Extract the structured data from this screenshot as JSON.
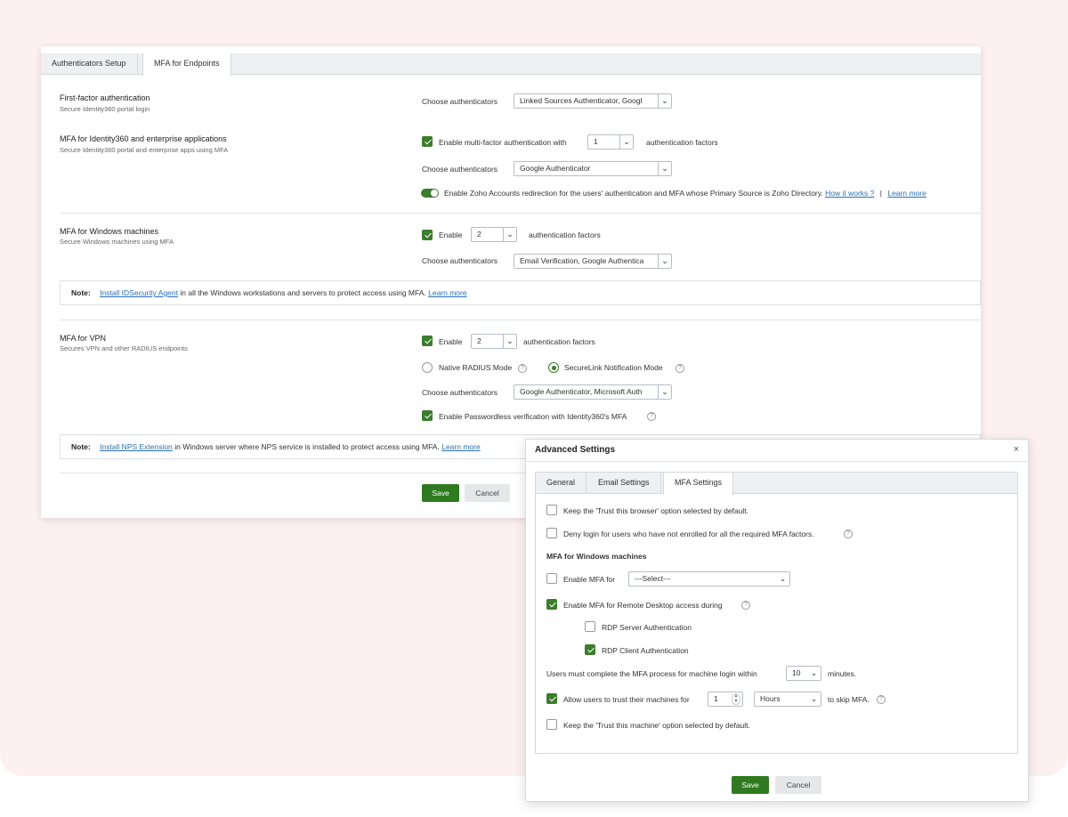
{
  "tabs": [
    "Authenticators Setup",
    "MFA for Endpoints"
  ],
  "first_factor": {
    "title": "First-factor authentication",
    "subtitle": "Secure Identity360 portal login",
    "choose_label": "Choose authenticators",
    "choose_value": "Linked Sources Authenticator, Googl"
  },
  "mfa_apps": {
    "title": "MFA for Identity360 and enterprise applications",
    "subtitle": "Secure Identity360 portal and enterprise apps using MFA",
    "enable_label": "Enable multi-factor authentication with",
    "factors_value": "1",
    "factors_label": "authentication factors",
    "choose_label": "Choose authenticators",
    "choose_value": "Google Authenticator",
    "zoho_text": "Enable Zoho Accounts redirection for the users' authentication and MFA whose Primary Source is Zoho Directory.",
    "how_link": "How it works ?",
    "separator": "|",
    "learn_link": "Learn more"
  },
  "mfa_windows": {
    "title": "MFA for Windows machines",
    "subtitle": "Secure Windows machines using MFA",
    "enable_label": "Enable",
    "factors_value": "2",
    "factors_label": "authentication factors",
    "choose_label": "Choose authenticators",
    "choose_value": "Email Verification, Google Authentica",
    "note_label": "Note:",
    "note_link": "Install IDSecurity Agent",
    "note_text": "in all the Windows workstations and servers to protect access using MFA.",
    "note_learn": "Learn more"
  },
  "mfa_vpn": {
    "title": "MFA for VPN",
    "subtitle": "Secures VPN and other RADIUS endpoints",
    "enable_label": "Enable",
    "factors_value": "2",
    "factors_label": "authentication factors",
    "radius_label": "Native RADIUS Mode",
    "securelink_label": "SecureLink Notification Mode",
    "choose_label": "Choose authenticators",
    "choose_value": "Google Authenticator, Microsoft Auth",
    "passwordless_label": "Enable Passwordless verification with Identity360's MFA",
    "note_label": "Note:",
    "note_link": "Install NPS Extension",
    "note_text": "in Windows server where NPS service is installed to protect access using MFA.",
    "note_learn": "Learn more"
  },
  "main_buttons": {
    "save": "Save",
    "cancel": "Cancel"
  },
  "dialog": {
    "title": "Advanced Settings",
    "close": "×",
    "tabs": [
      "General",
      "Email Settings",
      "MFA Settings"
    ],
    "trust_browser": "Keep the 'Trust this browser' option selected by default.",
    "deny_login": "Deny login for users who have not enrolled for all the required MFA factors.",
    "section_title": "MFA for Windows machines",
    "enable_mfa_for": "Enable MFA for",
    "select_placeholder": "---Select---",
    "rdp_label": "Enable MFA for Remote Desktop access during",
    "rdp_server": "RDP Server Authentication",
    "rdp_client": "RDP Client Authentication",
    "complete_pre": "Users must complete the MFA process for machine login within",
    "complete_value": "10",
    "complete_post": "minutes.",
    "trust_pre": "Allow users to trust their machines for",
    "trust_value": "1",
    "trust_unit": "Hours",
    "trust_post": "to skip MFA.",
    "trust_machine": "Keep the 'Trust this machine' option selected by default.",
    "save": "Save",
    "cancel": "Cancel"
  },
  "icons": {
    "help": "?",
    "chevron": "⌄"
  },
  "colors": {
    "accent": "#2f7a20",
    "link": "#2a6fb5",
    "background": "#fdf0f0"
  }
}
